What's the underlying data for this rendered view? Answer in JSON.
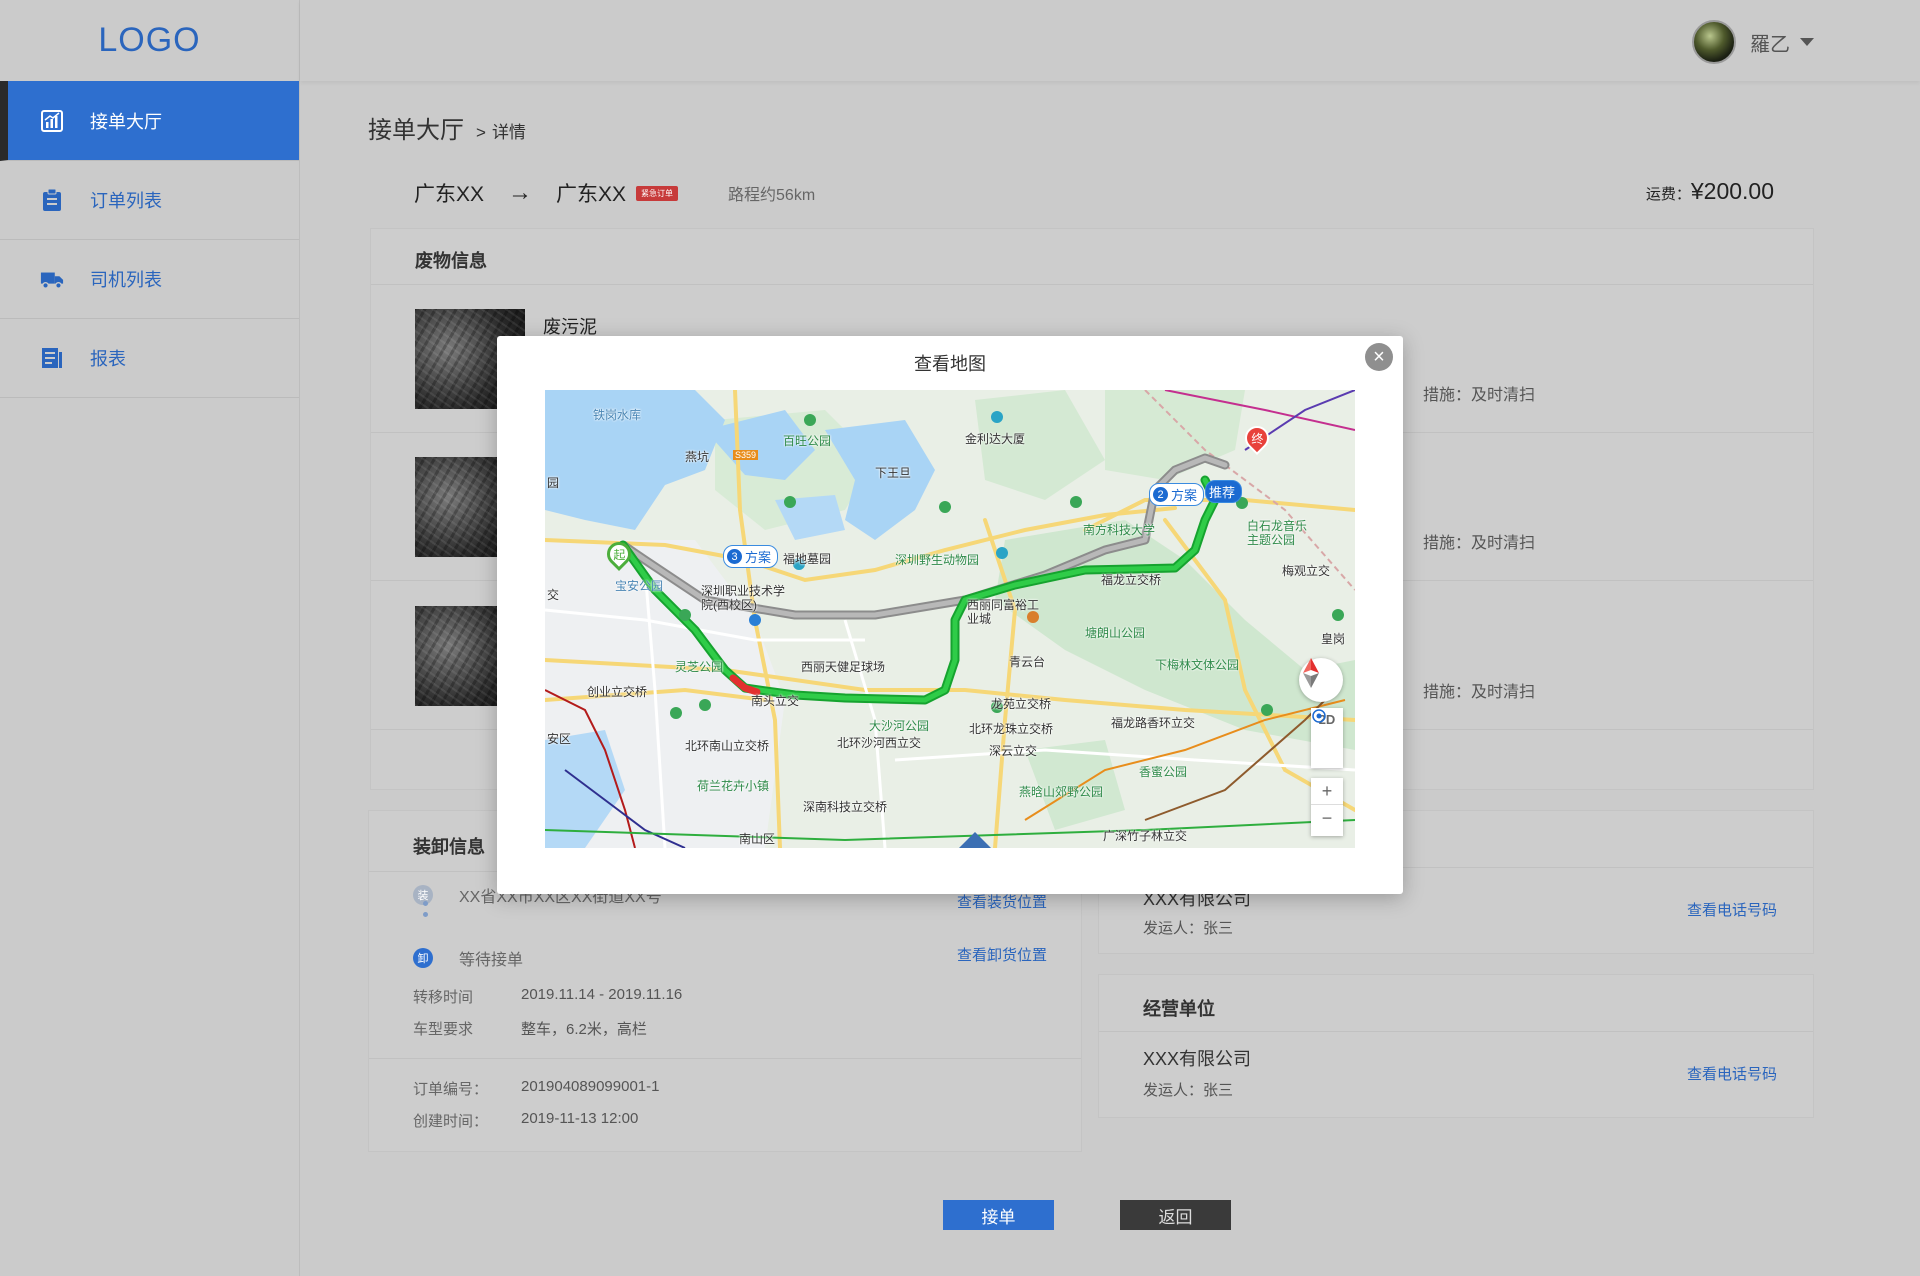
{
  "app": {
    "logo": "LOGO"
  },
  "sidebar": {
    "items": [
      {
        "label": "接单大厅",
        "icon": "chart-icon",
        "active": true
      },
      {
        "label": "订单列表",
        "icon": "clipboard-icon",
        "active": false
      },
      {
        "label": "司机列表",
        "icon": "truck-icon",
        "active": false
      },
      {
        "label": "报表",
        "icon": "report-icon",
        "active": false
      }
    ]
  },
  "header": {
    "username": "羅乙"
  },
  "breadcrumb": {
    "main": "接单大厅",
    "separator": ">",
    "sub": "详情"
  },
  "route": {
    "from": "广东XX",
    "arrow": "→",
    "to": "广东XX",
    "urgent_tag": "紧急订单",
    "distance": "路程约56km",
    "fare_label": "运费：",
    "fare_value": "¥200.00"
  },
  "waste": {
    "title": "废物信息",
    "items": [
      {
        "name": "废污泥",
        "measure": "措施：及时清扫"
      },
      {
        "name": "",
        "measure": "措施：及时清扫"
      },
      {
        "name": "",
        "measure": "措施：及时清扫"
      }
    ]
  },
  "loading": {
    "title": "装卸信息",
    "load_badge": "装",
    "load_address": "XX省XX市XX区XX街道XX号",
    "load_link": "查看装货位置",
    "unload_badge": "卸",
    "unload_status": "等待接单",
    "unload_link": "查看卸货位置",
    "transfer_time_label": "转移时间",
    "transfer_time": "2019.11.14 - 2019.11.16",
    "vehicle_label": "车型要求",
    "vehicle": "整车，6.2米，高栏",
    "order_no_label": "订单编号：",
    "order_no": "201904089099001-1",
    "created_label": "创建时间：",
    "created": "2019-11-13  12:00"
  },
  "shipper": {
    "name": "XXX有限公司",
    "contact": "发运人：张三",
    "link": "查看电话号码"
  },
  "operator": {
    "title": "经营单位",
    "name": "XXX有限公司",
    "contact": "发运人：张三",
    "link": "查看电话号码"
  },
  "actions": {
    "accept": "接单",
    "back": "返回"
  },
  "modal": {
    "title": "查看地图",
    "close": "×",
    "map": {
      "start_marker": "起",
      "end_marker": "终",
      "plan2": {
        "num": "2",
        "label": "方案"
      },
      "plan3": {
        "num": "3",
        "label": "方案"
      },
      "recommended": "推荐",
      "labels": [
        "铁岗水库",
        "百旺公园",
        "金利达大厦",
        "燕坑",
        "下王旦",
        "S359",
        "南方科技大学",
        "白石龙音乐主题公园",
        "梅观立交",
        "福地墓园",
        "深圳野生动物园",
        "宝安公园",
        "深圳职业技术学院(西校区)",
        "西丽同富裕工业城",
        "福龙立交桥",
        "塘朗山公园",
        "灵芝公园",
        "西丽天健足球场",
        "青云台",
        "下梅林文体公园",
        "创业立交桥",
        "南头立交",
        "龙苑立交桥",
        "福龙路香环立交",
        "大沙河公园",
        "北环龙珠立交桥",
        "北环南山立交桥",
        "北环沙河西立交",
        "深云立交",
        "香蜜公园",
        "荷兰花卉小镇",
        "燕晗山郊野公园",
        "深南科技立交桥",
        "南山区",
        "广深竹子林立交",
        "皇岗",
        "交",
        "园",
        "安区"
      ],
      "controls": {
        "mode": "2D",
        "zoom_in": "+",
        "zoom_out": "−"
      }
    }
  },
  "colors": {
    "accent": "#2e6fcf",
    "route_main": "#1fb33c",
    "route_alt": "#9a9a9a",
    "urgent": "#c73a3a"
  }
}
